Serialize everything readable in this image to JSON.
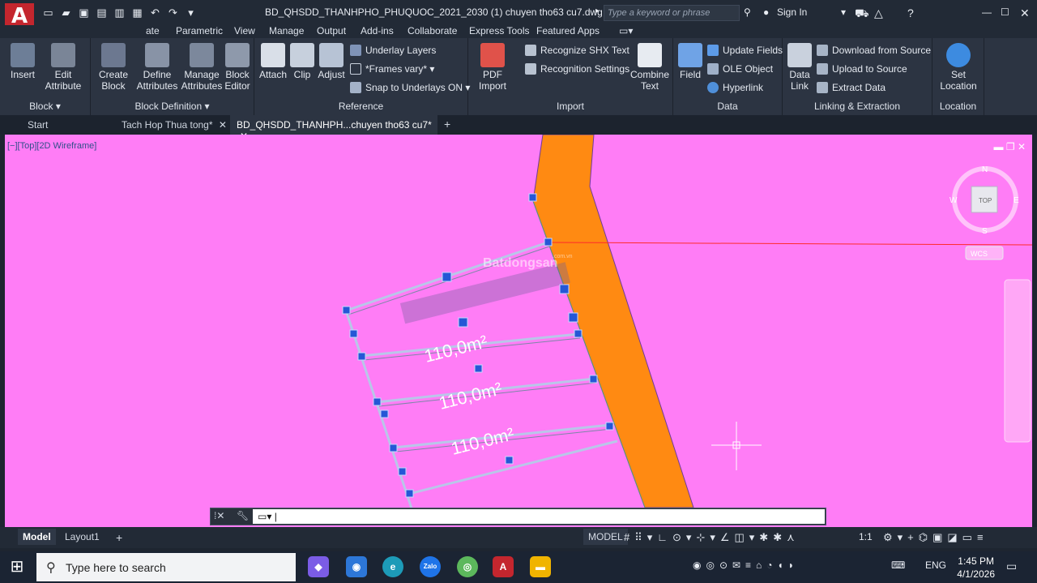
{
  "app": {
    "logo_letter": "A",
    "document_title": "BD_QHSDD_THANHPHO_PHUQUOC_2021_2030 (1) chuyen tho63 cu7.dwg",
    "search_placeholder": "Type a keyword or phrase",
    "sign_in": "Sign In"
  },
  "menu_tabs": [
    "ate",
    "Parametric",
    "View",
    "Manage",
    "Output",
    "Add-ins",
    "Collaborate",
    "Express Tools",
    "Featured Apps"
  ],
  "ribbon": {
    "block_panel": {
      "title": "Block",
      "insert": "Insert",
      "edit_attr_1": "Edit",
      "edit_attr_2": "Attribute"
    },
    "block_def_panel": {
      "title": "Block Definition",
      "create_1": "Create",
      "create_2": "Block",
      "define_1": "Define",
      "define_2": "Attributes",
      "manage_1": "Manage",
      "manage_2": "Attributes",
      "editor_1": "Block",
      "editor_2": "Editor"
    },
    "reference_panel": {
      "title": "Reference",
      "attach": "Attach",
      "clip": "Clip",
      "adjust": "Adjust",
      "underlay_layers": "Underlay Layers",
      "frames_vary": "*Frames vary*",
      "snap_underlays": "Snap to Underlays ON"
    },
    "import_panel": {
      "title": "Import",
      "pdf_1": "PDF",
      "pdf_2": "Import",
      "recognize_shx": "Recognize SHX Text",
      "recognition_settings": "Recognition Settings",
      "combine_1": "Combine",
      "combine_2": "Text"
    },
    "data_panel": {
      "title": "Data",
      "field": "Field",
      "update_fields": "Update Fields",
      "ole_object": "OLE Object",
      "hyperlink": "Hyperlink"
    },
    "linking_panel": {
      "title": "Linking & Extraction",
      "data_link_1": "Data",
      "data_link_2": "Link",
      "download": "Download from Source",
      "upload": "Upload to Source",
      "extract": "Extract  Data"
    },
    "location_panel": {
      "title": "Location",
      "set_1": "Set",
      "set_2": "Location"
    }
  },
  "doc_tabs": [
    "Start",
    "Tach Hop Thua tong*",
    "BD_QHSDD_THANHPH...chuyen tho63 cu7*"
  ],
  "viewport": {
    "label": "[−][Top][2D Wireframe]",
    "watermark": "Batdongsan",
    "watermark_small": ".com.vn",
    "parcel_labels": [
      "110,0m²",
      "110,0m²",
      "110,0m²"
    ],
    "viewcube": {
      "top": "TOP",
      "n": "N",
      "s": "S",
      "e": "E",
      "w": "W",
      "wcs": "WCS"
    }
  },
  "status": {
    "model_tab": "Model",
    "layout_tab": "Layout1",
    "model_label": "MODEL",
    "scale": "1:1"
  },
  "taskbar": {
    "search_placeholder": "Type here to search",
    "lang": "ENG",
    "time": "1:45 PM",
    "date": "4/1/2026"
  },
  "colors": {
    "canvas": "#ff7df6",
    "road": "#ff8a12",
    "parcel_line": "#b9c6e9",
    "grip": "#2557d6"
  }
}
